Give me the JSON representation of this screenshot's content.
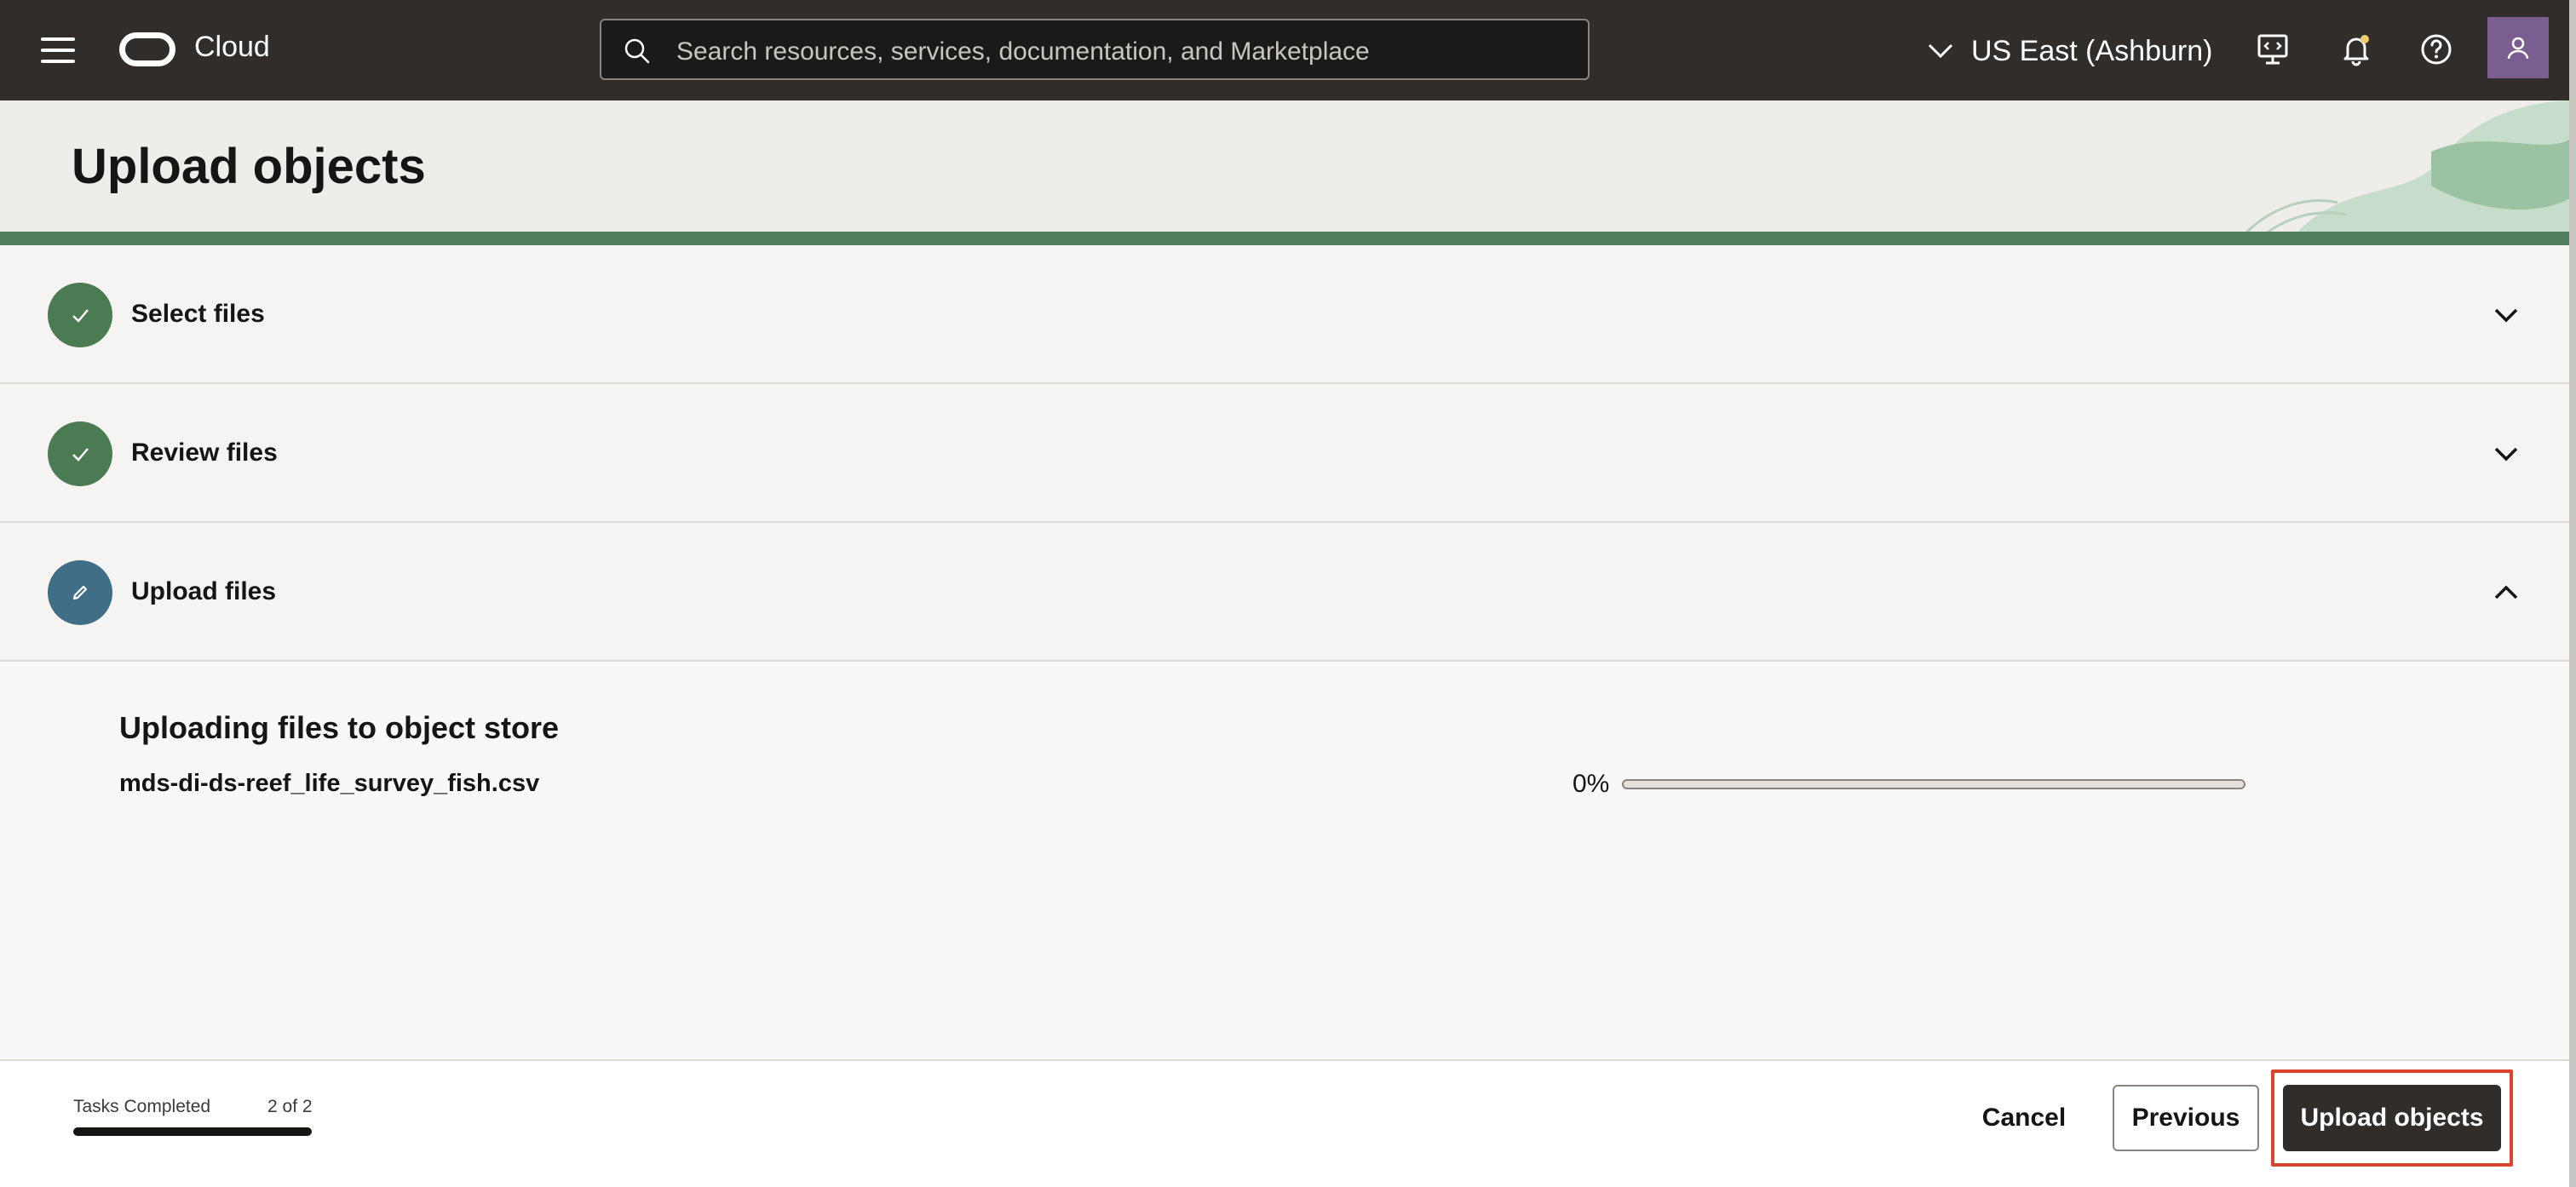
{
  "topbar": {
    "brand": "Cloud",
    "search_placeholder": "Search resources, services, documentation, and Marketplace",
    "region": "US East (Ashburn)",
    "icons": [
      "menu-icon",
      "chevron-down-icon",
      "developer-tools-icon",
      "bell-icon",
      "help-icon",
      "user-icon"
    ]
  },
  "page": {
    "title": "Upload objects"
  },
  "steps": [
    {
      "label": "Select files",
      "status": "completed"
    },
    {
      "label": "Review files",
      "status": "completed"
    },
    {
      "label": "Upload files",
      "status": "active"
    }
  ],
  "upload": {
    "heading": "Uploading files to object store",
    "files": [
      {
        "name": "mds-di-ds-reef_life_survey_fish.csv",
        "progress_text": "0%",
        "progress": 0
      }
    ]
  },
  "footer": {
    "tasks_label": "Tasks Completed",
    "tasks_count": "2 of 2",
    "tasks_progress": 1.0,
    "cancel_label": "Cancel",
    "previous_label": "Previous",
    "upload_label": "Upload objects"
  },
  "colors": {
    "topbar": "#312d2a",
    "step_done": "#4a7b52",
    "step_active": "#3f6e86",
    "primary_button": "#312d2a",
    "highlight": "#d9452f"
  }
}
